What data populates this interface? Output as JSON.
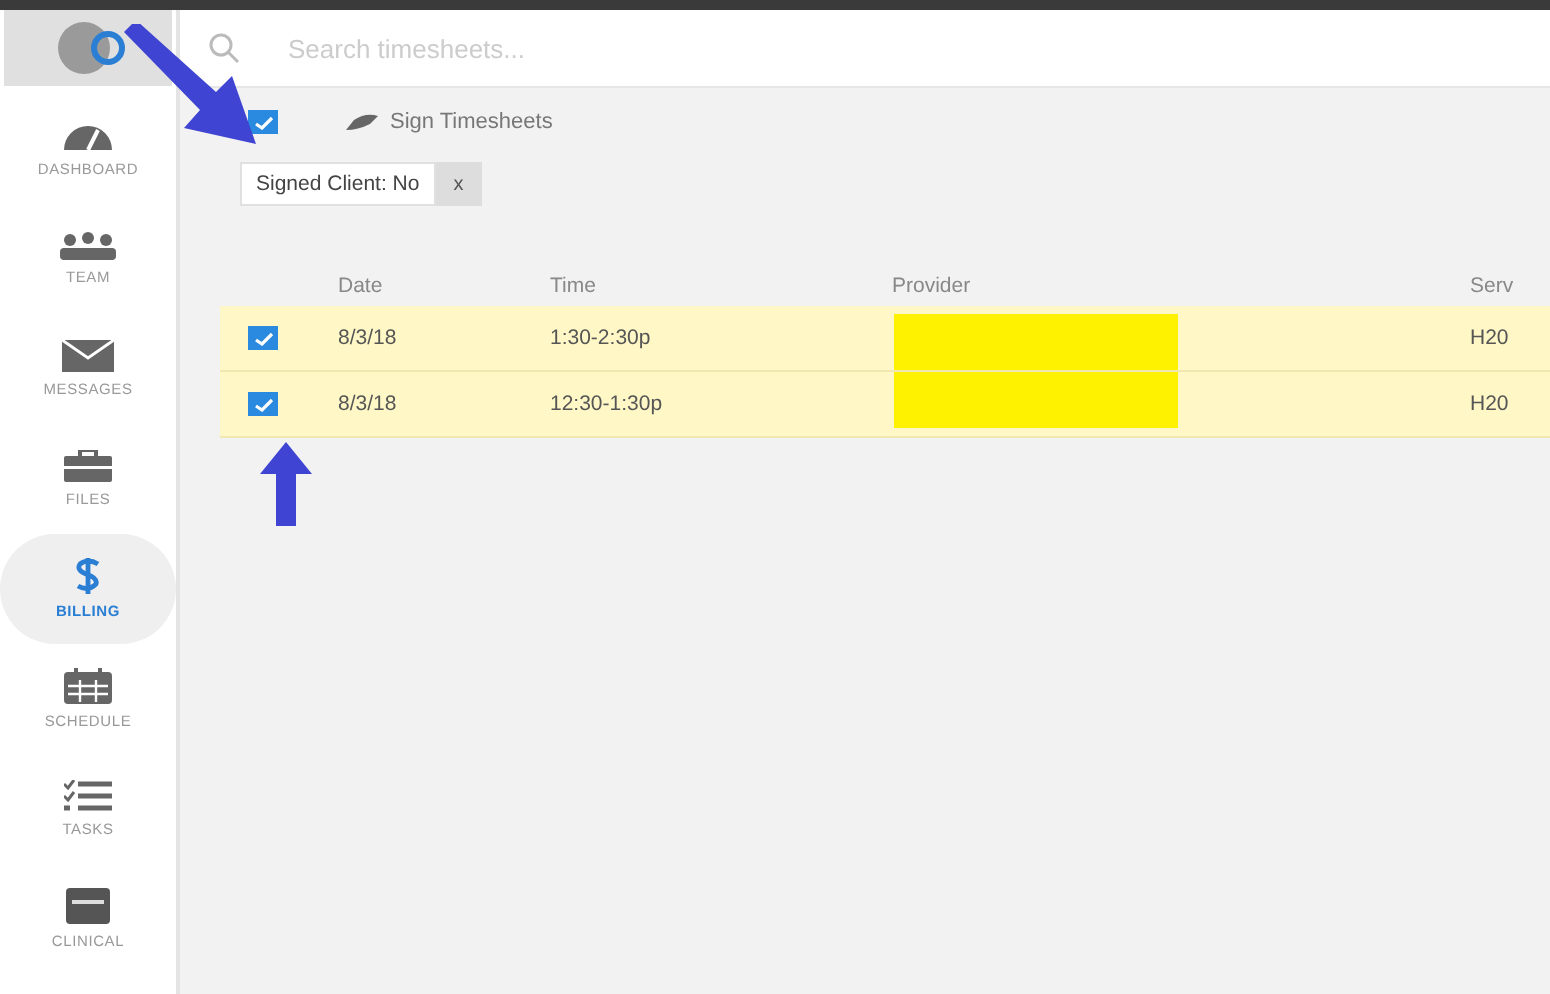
{
  "search": {
    "placeholder": "Search timesheets..."
  },
  "sidebar": {
    "items": [
      {
        "label": "DASHBOARD",
        "selected": false
      },
      {
        "label": "TEAM",
        "selected": false
      },
      {
        "label": "MESSAGES",
        "selected": false
      },
      {
        "label": "FILES",
        "selected": false
      },
      {
        "label": "BILLING",
        "selected": true
      },
      {
        "label": "SCHEDULE",
        "selected": false
      },
      {
        "label": "TASKS",
        "selected": false
      },
      {
        "label": "CLINICAL",
        "selected": false
      }
    ]
  },
  "toolbar": {
    "select_all_checked": true,
    "action": "Sign Timesheets"
  },
  "filters": [
    {
      "label": "Signed Client: No",
      "remove": "x"
    }
  ],
  "table": {
    "columns": [
      "Date",
      "Time",
      "Provider",
      "Serv"
    ],
    "rows": [
      {
        "checked": true,
        "selected": true,
        "date": "8/3/18",
        "time": "1:30-2:30p",
        "service": "H20"
      },
      {
        "checked": true,
        "selected": true,
        "date": "8/3/18",
        "time": "12:30-1:30p",
        "service": "H20"
      }
    ]
  }
}
